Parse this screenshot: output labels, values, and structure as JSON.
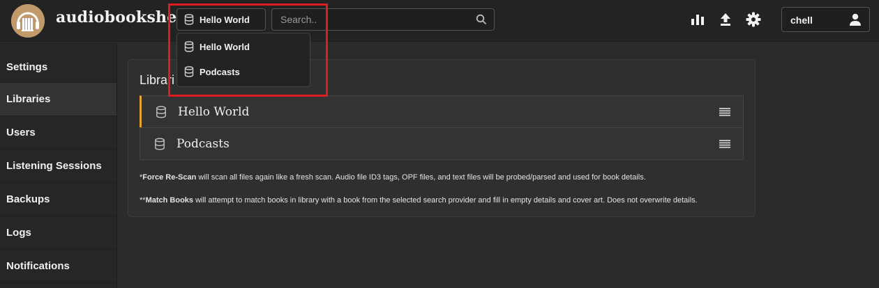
{
  "app": {
    "title": "audiobookshelf"
  },
  "header": {
    "library_select": {
      "value": "Hello World"
    },
    "search": {
      "placeholder": "Search.."
    },
    "user": {
      "name": "chell"
    }
  },
  "dropdown": {
    "items": [
      {
        "label": "Hello World"
      },
      {
        "label": "Podcasts"
      }
    ]
  },
  "sidebar": {
    "items": [
      {
        "label": "Settings"
      },
      {
        "label": "Libraries"
      },
      {
        "label": "Users"
      },
      {
        "label": "Listening Sessions"
      },
      {
        "label": "Backups"
      },
      {
        "label": "Logs"
      },
      {
        "label": "Notifications"
      }
    ],
    "active": "Libraries"
  },
  "main": {
    "card_title_visible": "Librari",
    "libraries": [
      {
        "name": "Hello World"
      },
      {
        "name": "Podcasts"
      }
    ],
    "notes": [
      {
        "prefix": "*",
        "bold": "Force Re-Scan",
        "text": " will scan all files again like a fresh scan. Audio file ID3 tags, OPF files, and text files will be probed/parsed and used for book details."
      },
      {
        "prefix": "**",
        "bold": "Match Books",
        "text": " will attempt to match books in library with a book from the selected search provider and fill in empty details and cover art. Does not overwrite details."
      }
    ]
  },
  "icons": {
    "logo": "audiobookshelf-logo",
    "library": "database-icon",
    "search": "search-icon",
    "stats": "bar-chart-icon",
    "upload": "upload-icon",
    "settings": "gear-icon",
    "user": "person-icon",
    "drag": "drag-handle-icon"
  },
  "colors": {
    "selected_accent": "#e5a630",
    "highlight_box": "#e11b22",
    "logo_bg": "#c19a6b"
  }
}
